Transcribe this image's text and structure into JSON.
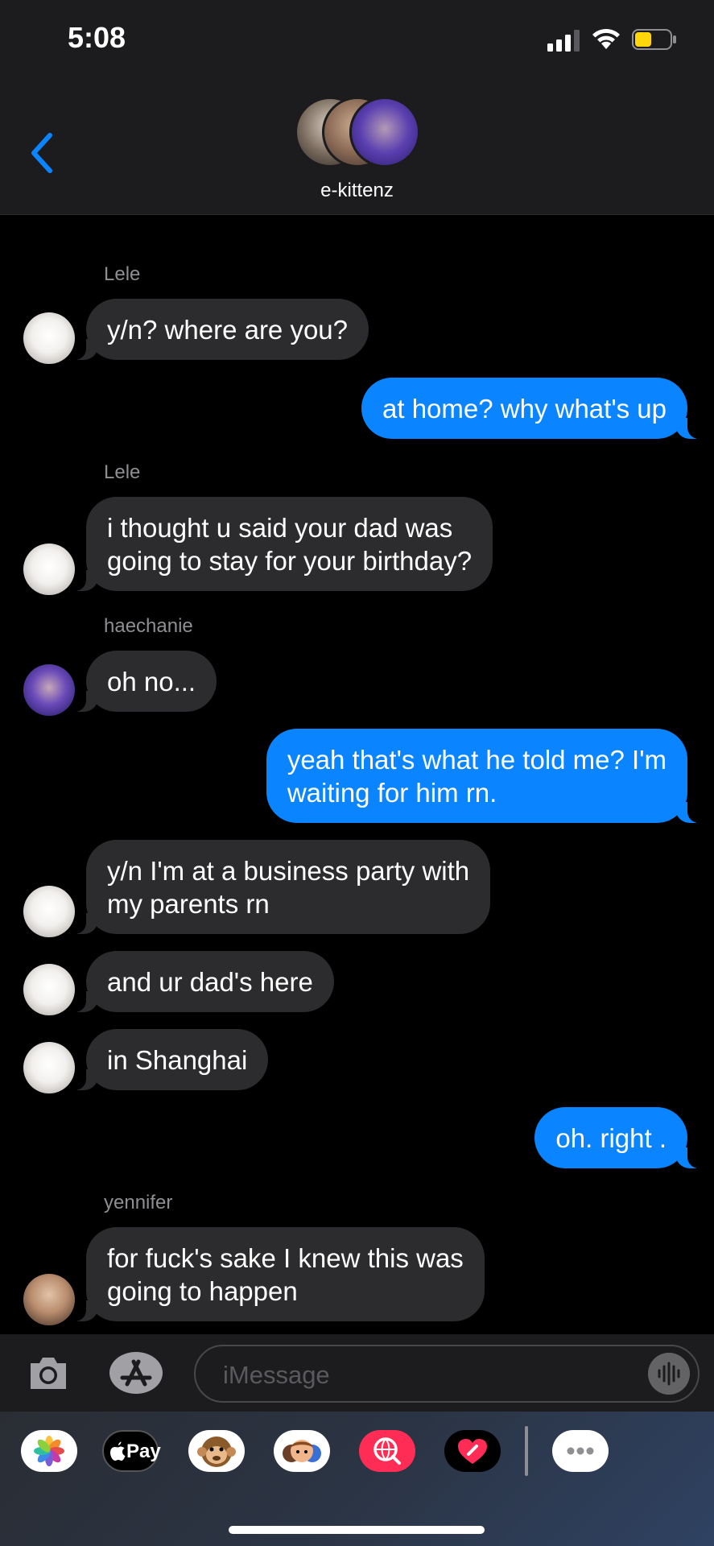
{
  "status_bar": {
    "time": "5:08",
    "icons": [
      "signal-icon",
      "wifi-icon",
      "battery-icon"
    ]
  },
  "header": {
    "back_icon": "chevron-left-icon",
    "group_name": "e-kittenz",
    "avatar_count": 3
  },
  "messages": [
    {
      "sender": "Lele",
      "direction": "incoming",
      "lines": [
        "y/n? where are you?"
      ]
    },
    {
      "sender": "",
      "direction": "outgoing",
      "lines": [
        "at home? why what's up"
      ]
    },
    {
      "sender": "Lele",
      "direction": "incoming",
      "lines": [
        "i thought u said your dad was",
        "going to stay for your birthday?"
      ]
    },
    {
      "sender": "haechanie",
      "direction": "incoming",
      "lines": [
        "oh no..."
      ]
    },
    {
      "sender": "",
      "direction": "outgoing",
      "lines": [
        "yeah that's what he told me? I'm",
        "waiting for him rn."
      ]
    },
    {
      "sender": "",
      "direction": "incoming",
      "lines": [
        "y/n I'm at a business party with",
        "my parents rn"
      ]
    },
    {
      "sender": "",
      "direction": "incoming",
      "lines": [
        "and ur dad's here"
      ]
    },
    {
      "sender": "",
      "direction": "incoming",
      "lines": [
        "in Shanghai"
      ]
    },
    {
      "sender": "",
      "direction": "outgoing",
      "lines": [
        "oh. right ."
      ]
    },
    {
      "sender": "yennifer",
      "direction": "incoming",
      "lines": [
        "for fuck's sake I knew this was",
        "going to happen"
      ]
    }
  ],
  "input_bar": {
    "placeholder": "iMessage",
    "icons": [
      "camera-icon",
      "app-store-icon",
      "audio-waveform-icon"
    ]
  },
  "app_drawer": {
    "apps": [
      "photos-app-icon",
      "apple-pay-icon",
      "animoji-icon",
      "memoji-icon",
      "web-search-icon",
      "digital-touch-icon",
      "more-apps-icon"
    ],
    "apple_pay_label": "Pay"
  },
  "colors": {
    "outgoing_bubble": "#0a84ff",
    "incoming_bubble": "#2c2c2e",
    "header_bg": "#1c1c1e",
    "background": "#000000"
  }
}
